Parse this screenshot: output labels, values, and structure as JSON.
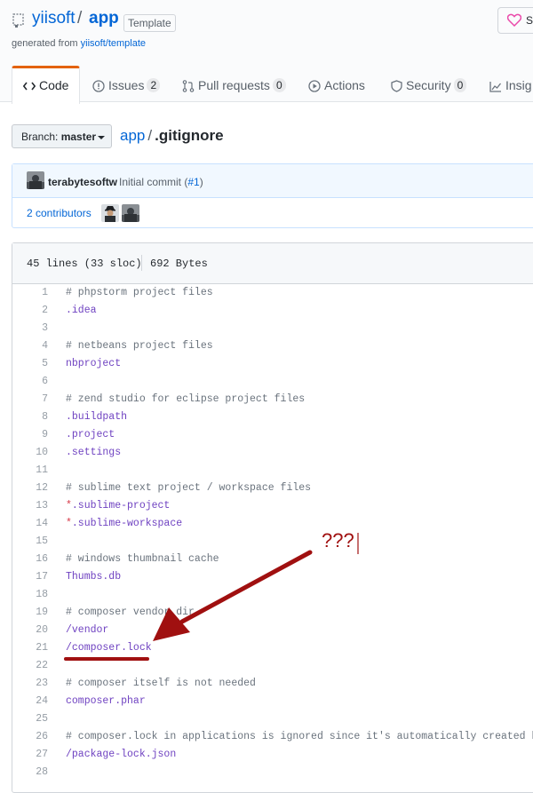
{
  "repo": {
    "owner": "yiisoft",
    "separator": "/",
    "name": "app",
    "badge": "Template",
    "generated_prefix": "generated from",
    "generated_link": "yiisoft/template",
    "sponsor_label": "Sp"
  },
  "tabs": [
    {
      "label": "Code",
      "icon": "code-icon",
      "selected": true
    },
    {
      "label": "Issues",
      "count": "2",
      "icon": "issue-icon"
    },
    {
      "label": "Pull requests",
      "count": "0",
      "icon": "git-pull-request-icon"
    },
    {
      "label": "Actions",
      "icon": "play-icon"
    },
    {
      "label": "Security",
      "count": "0",
      "icon": "shield-icon"
    },
    {
      "label": "Insig",
      "icon": "graph-icon"
    }
  ],
  "branch": {
    "prefix": "Branch:",
    "name": "master"
  },
  "breadcrumb": {
    "repo": "app",
    "separator": "/",
    "file": ".gitignore"
  },
  "commit": {
    "author": "terabytesoftw",
    "message": "Initial commit (",
    "pr": "#1",
    "message_end": ")",
    "contributors": "2 contributors"
  },
  "file": {
    "lines_info": "45 lines (33 sloc)",
    "size": "692 Bytes"
  },
  "code_lines": [
    {
      "n": "1",
      "text": "# phpstorm project files",
      "kind": "comment"
    },
    {
      "n": "2",
      "text": ".idea",
      "kind": "path"
    },
    {
      "n": "3",
      "text": "",
      "kind": "plain"
    },
    {
      "n": "4",
      "text": "# netbeans project files",
      "kind": "comment"
    },
    {
      "n": "5",
      "text": "nbproject",
      "kind": "path"
    },
    {
      "n": "6",
      "text": "",
      "kind": "plain"
    },
    {
      "n": "7",
      "text": "# zend studio for eclipse project files",
      "kind": "comment"
    },
    {
      "n": "8",
      "text": ".buildpath",
      "kind": "path"
    },
    {
      "n": "9",
      "text": ".project",
      "kind": "path"
    },
    {
      "n": "10",
      "text": ".settings",
      "kind": "path"
    },
    {
      "n": "11",
      "text": "",
      "kind": "plain"
    },
    {
      "n": "12",
      "text": "# sublime text project / workspace files",
      "kind": "comment"
    },
    {
      "n": "13",
      "text": "*.sublime-project",
      "kind": "glob"
    },
    {
      "n": "14",
      "text": "*.sublime-workspace",
      "kind": "glob"
    },
    {
      "n": "15",
      "text": "",
      "kind": "plain"
    },
    {
      "n": "16",
      "text": "# windows thumbnail cache",
      "kind": "comment"
    },
    {
      "n": "17",
      "text": "Thumbs.db",
      "kind": "path"
    },
    {
      "n": "18",
      "text": "",
      "kind": "plain"
    },
    {
      "n": "19",
      "text": "# composer vendor dir",
      "kind": "comment"
    },
    {
      "n": "20",
      "text": "/vendor",
      "kind": "path"
    },
    {
      "n": "21",
      "text": "/composer.lock",
      "kind": "path"
    },
    {
      "n": "22",
      "text": "",
      "kind": "plain"
    },
    {
      "n": "23",
      "text": "# composer itself is not needed",
      "kind": "comment"
    },
    {
      "n": "24",
      "text": "composer.phar",
      "kind": "path"
    },
    {
      "n": "25",
      "text": "",
      "kind": "plain"
    },
    {
      "n": "26",
      "text": "# composer.lock in applications is ignored since it's automatically created by c",
      "kind": "comment"
    },
    {
      "n": "27",
      "text": "/package-lock.json",
      "kind": "path"
    },
    {
      "n": "28",
      "text": "",
      "kind": "plain"
    }
  ],
  "annotation": {
    "text": "???",
    "color": "#a01010"
  },
  "colors": {
    "link": "#0366d6",
    "tab_accent": "#e36209",
    "comment": "#6a737d",
    "path": "#6f42c1",
    "glob_star": "#d73a49"
  }
}
